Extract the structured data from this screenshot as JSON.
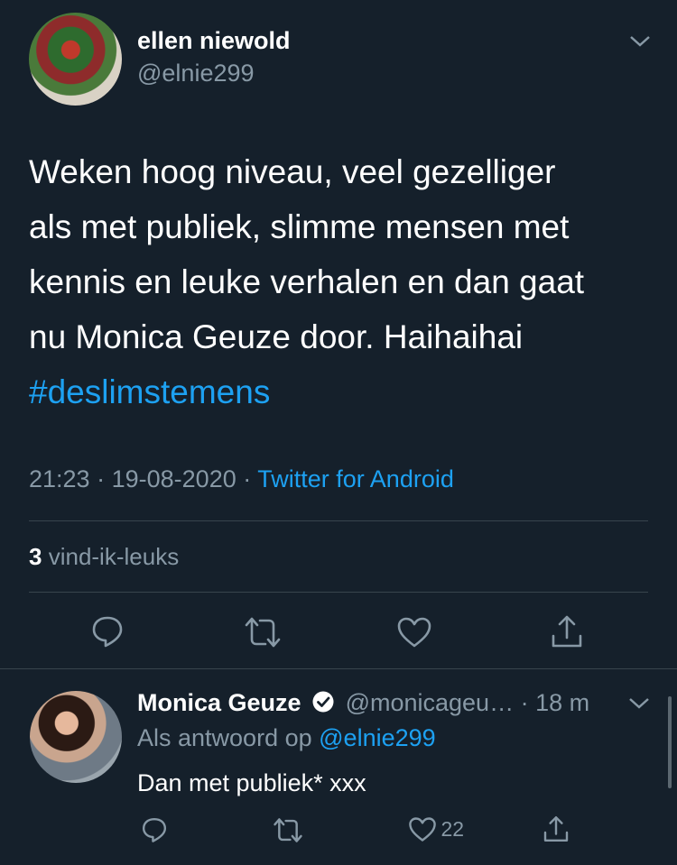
{
  "colors": {
    "background": "#15202b",
    "text": "#ffffff",
    "muted": "#8899a6",
    "accent": "#1da1f2",
    "divider": "#38444d"
  },
  "tweet": {
    "display_name": "ellen niewold",
    "handle": "@elnie299",
    "text_lines": [
      "Weken hoog niveau, veel gezelliger",
      "als met publiek, slimme mensen met",
      "kennis en leuke verhalen en dan gaat",
      "nu Monica Geuze door. Haihaihai"
    ],
    "hashtag": "#deslimstemens",
    "time": "21:23",
    "date": "19-08-2020",
    "source": "Twitter for Android",
    "separator": "·",
    "likes_count": "3",
    "likes_label": "vind-ik-leuks",
    "menu_icon": "chevron-down-icon"
  },
  "actions": {
    "reply_icon": "reply-icon",
    "retweet_icon": "retweet-icon",
    "like_icon": "heart-icon",
    "share_icon": "share-icon"
  },
  "reply": {
    "display_name": "Monica Geuze",
    "verified_icon": "verified-badge-icon",
    "handle": "@monicageu…",
    "separator": "·",
    "age": "18 m",
    "replying_to_prefix": "Als antwoord op",
    "replying_to_handle": "@elnie299",
    "text": "Dan met publiek* xxx",
    "like_count": "22"
  }
}
